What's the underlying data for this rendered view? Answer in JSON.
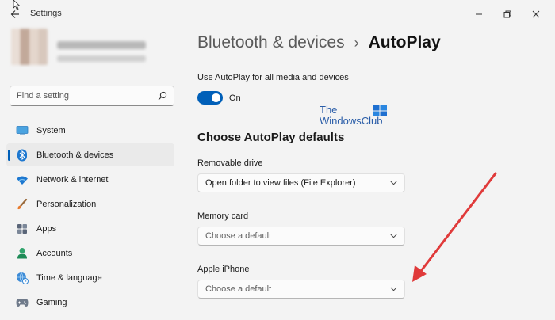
{
  "window": {
    "title": "Settings"
  },
  "search": {
    "placeholder": "Find a setting"
  },
  "nav": {
    "items": [
      {
        "label": "System",
        "icon": "monitor-icon"
      },
      {
        "label": "Bluetooth & devices",
        "icon": "bluetooth-icon",
        "active": true
      },
      {
        "label": "Network & internet",
        "icon": "wifi-icon"
      },
      {
        "label": "Personalization",
        "icon": "brush-icon"
      },
      {
        "label": "Apps",
        "icon": "apps-icon"
      },
      {
        "label": "Accounts",
        "icon": "person-icon"
      },
      {
        "label": "Time & language",
        "icon": "globe-clock-icon"
      },
      {
        "label": "Gaming",
        "icon": "gamepad-icon"
      }
    ]
  },
  "header": {
    "parent": "Bluetooth & devices",
    "separator": "›",
    "current": "AutoPlay"
  },
  "autoplay": {
    "label": "Use AutoPlay for all media and devices",
    "state": "On",
    "enabled": true
  },
  "watermark": {
    "line1": "The",
    "line2": "WindowsClub"
  },
  "defaults": {
    "heading": "Choose AutoPlay defaults",
    "fields": [
      {
        "label": "Removable drive",
        "value": "Open folder to view files (File Explorer)"
      },
      {
        "label": "Memory card",
        "value": "Choose a default"
      },
      {
        "label": "Apple iPhone",
        "value": "Choose a default"
      }
    ]
  },
  "colors": {
    "accent": "#005fb8",
    "annotation_arrow": "#e03a3a",
    "background": "#f3f3f3"
  }
}
